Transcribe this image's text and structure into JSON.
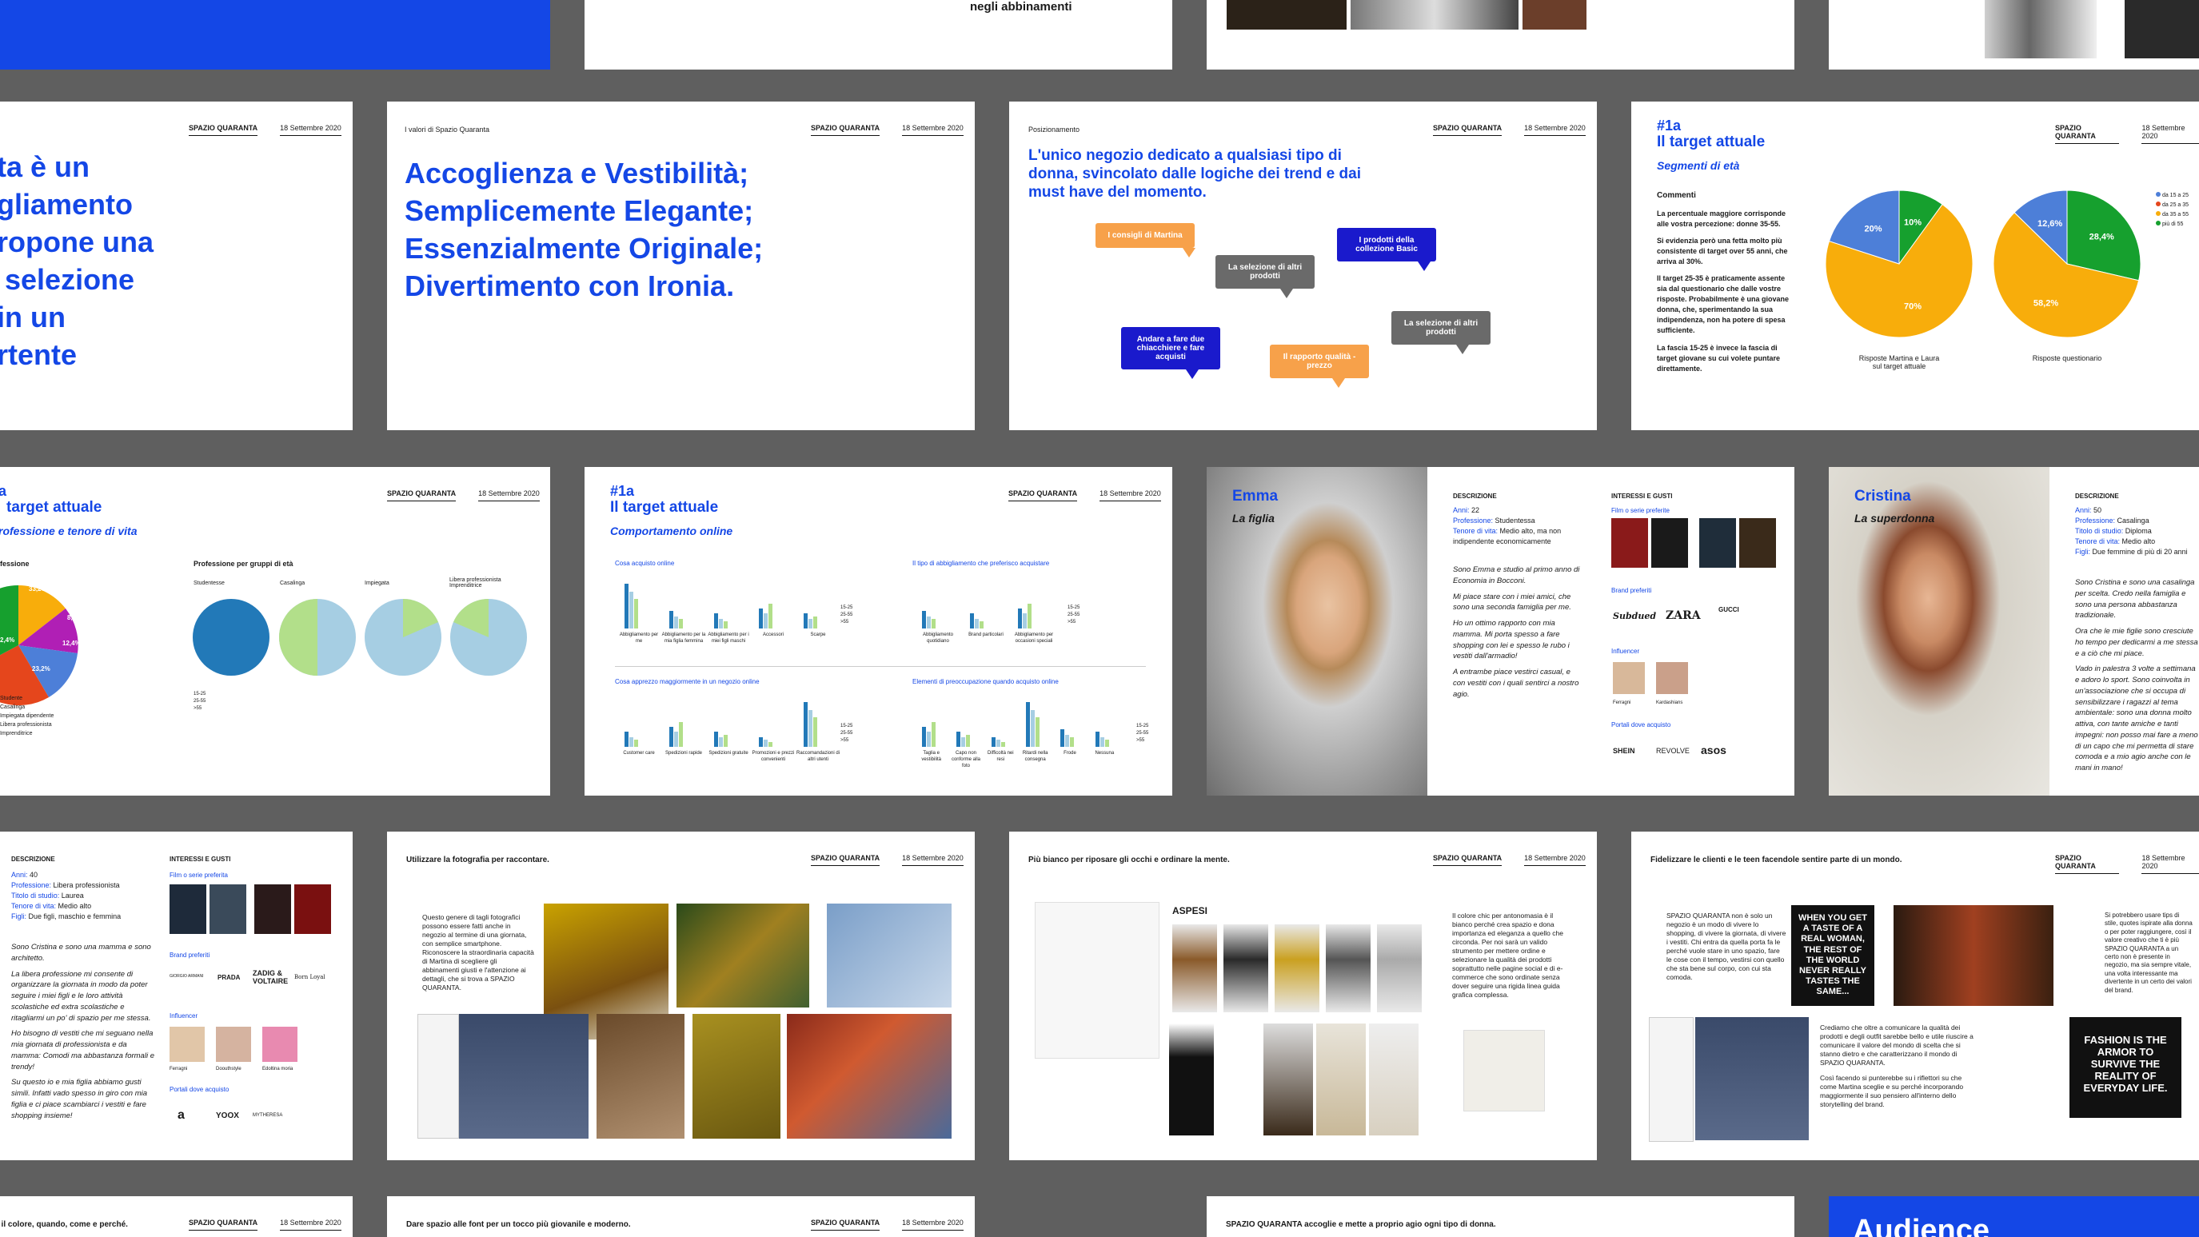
{
  "colors": {
    "accent": "#1447e6",
    "bg": "#5f5f5f",
    "orange": "#f7a14a",
    "gray": "#6a6a6a",
    "navy": "#1a1acc",
    "pie_blue": "#4d7fd8",
    "pie_orange": "#f8ad0b",
    "pie_green": "#16a02e",
    "pie_red": "#e5461c"
  },
  "top_row": {
    "subtitle": "negli abbinamenti"
  },
  "header": {
    "brand": "SPAZIO QUARANTA",
    "date": "18 Settembre 2020"
  },
  "slide_claim": {
    "lines": [
      "ta è un",
      "gliamento",
      "ropone una",
      " selezione",
      "in un",
      "rtente"
    ]
  },
  "slide_values": {
    "section": "I valori di Spazio Quaranta",
    "lines": [
      "Accoglienza e Vestibilità;",
      "Semplicemente Elegante;",
      "Essenzialmente Originale;",
      "Divertimento con Ironia."
    ]
  },
  "slide_position": {
    "section": "Posizionamento",
    "statement": "L'unico negozio dedicato a qualsiasi tipo di donna, svincolato dalle logiche dei trend e dai must have del momento.",
    "bubbles": [
      "I consigli di Martina",
      "La selezione di altri prodotti",
      "I prodotti della collezione Basic",
      "Andare a fare due chiacchiere e fare acquisti",
      "Il rapporto qualità - prezzo",
      "La selezione di altri prodotti"
    ]
  },
  "slide_target": {
    "tag": "#1a",
    "title": "Il target attuale",
    "subtitle": "Segmenti di età",
    "comments_label": "Commenti",
    "paragraphs": [
      "La percentuale maggiore corrisponde alle vostra percezione: donne 35-55.",
      "Si evidenzia però una fetta molto più consistente di target over 55 anni, che arriva al 30%.",
      "Il target 25-35 è praticamente assente sia dal questionario che dalle vostre risposte. Probabilmente è una giovane donna, che, sperimentando la sua indipendenza, non ha potere di spesa sufficiente.",
      "La fascia 15-25 è invece la fascia di target giovane su cui volete puntare direttamente."
    ],
    "pie1_caption": "Risposte Martina e Laura sul target attuale",
    "pie2_caption": "Risposte questionario",
    "legend": [
      "da 15 a 25",
      "da 25 a 35",
      "da 35 a 55",
      "più di 55"
    ]
  },
  "chart_data": [
    {
      "type": "pie",
      "title": "",
      "labels": [
        "da 15 a 25",
        "da 35 a 55",
        "più di 55"
      ],
      "values": [
        10,
        70,
        20
      ],
      "value_labels": [
        "10%",
        "70%",
        "20%"
      ]
    },
    {
      "type": "pie",
      "title": "",
      "labels": [
        "da 15 a 25",
        "da 35 a 55",
        "più di 55"
      ],
      "values": [
        28.4,
        58.2,
        12.6
      ],
      "value_labels": [
        "28,4%",
        "58,2%",
        "12,6%"
      ]
    }
  ],
  "slide_profession": {
    "tag": "a",
    "title": "target attuale",
    "subtitle": "rofessione e tenore di vita",
    "pie_label": "fessione",
    "pie_values": [
      "33,2%",
      "8,9%",
      "12,4%",
      "23,2%",
      "2,4%"
    ],
    "legend": [
      "Studente",
      "Casalinga",
      "Impiegata dipendente",
      "Libera professionista",
      "Imprenditrice"
    ],
    "group_title": "Professione per gruppi di età",
    "groups": [
      "Studentesse",
      "Casalinga",
      "Impiegata",
      "Libera professionista Imprenditrice"
    ],
    "group_legend": [
      "15-25",
      "25-55",
      ">55"
    ]
  },
  "slide_online": {
    "tag": "#1a",
    "title": "Il target attuale",
    "subtitle": "Comportamento online",
    "charts": [
      {
        "title": "Cosa acquisto online",
        "cats": [
          "Abbigliamento per me",
          "Abbigliamento per la mia figlia femmina",
          "Abbigliamento per i miei figli maschi",
          "Accessori",
          "Scarpe"
        ]
      },
      {
        "title": "Il tipo di abbigliamento che preferisco acquistare",
        "cats": [
          "Abbigliamento quotidiano",
          "Brand particolari",
          "Abbigliamento per occasioni speciali"
        ]
      },
      {
        "title": "Cosa apprezzo maggiormente in un negozio online",
        "cats": [
          "Customer care",
          "Spedizioni rapide",
          "Spedizioni gratuite",
          "Promozioni e prezzi convenienti",
          "Raccomandazioni di altri utenti"
        ]
      },
      {
        "title": "Elementi di preoccupazione quando acquisto online",
        "cats": [
          "Taglia e vestibilità",
          "Capo non conforme alla foto",
          "Difficoltà nei resi",
          "Ritardi nella consegna",
          "Frode",
          "Nessuna"
        ]
      }
    ],
    "legend": [
      "15-25",
      "25-55",
      ">55"
    ]
  },
  "persona_emma": {
    "name": "Emma",
    "role": "La figlia",
    "desc_label": "DESCRIZIONE",
    "facts": [
      [
        "Anni:",
        "22"
      ],
      [
        "Professione:",
        "Studentessa"
      ],
      [
        "Tenore di vita:",
        "Medio alto, ma non indipendente economicamente"
      ]
    ],
    "story": [
      "Sono Emma e studio al primo anno di Economia in Bocconi.",
      "Mi piace stare con i miei amici, che sono una seconda famiglia per me.",
      "Ho un ottimo rapporto con mia mamma. Mi porta spesso a fare shopping con lei e spesso le rubo i vestiti dall'armadio!",
      "A entrambe piace vestirci casual, e con vestiti con i quali sentirci a nostro agio."
    ],
    "interests_label": "INTERESSI E GUSTI",
    "films_label": "Film o serie preferite",
    "brands_label": "Brand preferiti",
    "brands": [
      "Subdued",
      "ZARA",
      "GUCCI"
    ],
    "influencer_label": "Influencer",
    "influencers": [
      "Ferragni",
      "Kardashians"
    ],
    "portals_label": "Portali dove acquisto",
    "portals": [
      "SHEIN",
      "REVOLVE",
      "asos"
    ]
  },
  "persona_cristina": {
    "name": "Cristina",
    "role": "La superdonna",
    "desc_label": "DESCRIZIONE",
    "facts": [
      [
        "Anni:",
        "50"
      ],
      [
        "Professione:",
        "Casalinga"
      ],
      [
        "Titolo di studio:",
        "Diploma"
      ],
      [
        "Tenore di vita:",
        "Medio alto"
      ],
      [
        "Figli:",
        "Due femmine di più di 20 anni"
      ]
    ],
    "story": [
      "Sono Cristina e sono una casalinga per scelta. Credo nella famiglia e sono una persona abbastanza tradizionale.",
      "Ora che le mie figlie sono cresciute ho tempo per dedicarmi a me stessa e a ciò che mi piace.",
      "Vado in palestra 3 volte a settimana e adoro lo sport. Sono coinvolta in un'associazione che si occupa di sensibilizzare i ragazzi al tema ambientale: sono una donna molto attiva, con tante amiche e tanti impegni: non posso mai fare a meno di un capo che mi permetta di stare comoda e a mio agio anche con le mani in mano!"
    ]
  },
  "persona_third": {
    "desc_label": "DESCRIZIONE",
    "facts": [
      [
        "Anni:",
        "40"
      ],
      [
        "Professione:",
        "Libera professionista"
      ],
      [
        "Titolo di studio:",
        "Laurea"
      ],
      [
        "Tenore di vita:",
        "Medio alto"
      ],
      [
        "Figli:",
        "Due figli, maschio e femmina"
      ]
    ],
    "story": [
      "Sono Cristina e sono una mamma e sono architetto.",
      "La libera professione mi consente di organizzare la giornata in modo da poter seguire i miei figli e le loro attività scolastiche ed extra scolastiche e ritagliarmi un po' di spazio per me stessa.",
      "Ho bisogno di vestiti che mi seguano nella mia giornata di professionista e da mamma: Comodi ma abbastanza formali e trendy!",
      "Su questo io e mia figlia abbiamo gusti simili. Infatti vado spesso in giro con mia figlia e ci piace scambiarci i vestiti e fare shopping insieme!"
    ],
    "interests_label": "INTERESSI E GUSTI",
    "films_label": "Film o serie preferita",
    "brands_label": "Brand preferiti",
    "brands": [
      "GIORGIO ARMANI",
      "PRADA",
      "ZADIG & VOLTAIRE",
      "Born Loyal"
    ],
    "influencer_label": "Influencer",
    "influencers": [
      "Ferragni",
      "Doouthstyle",
      "Edoltina moria"
    ],
    "portals_label": "Portali dove acquisto",
    "portals": [
      "a",
      "YOOX",
      "MYTHERESA"
    ]
  },
  "slide_photo": {
    "title": "Utilizzare la fotografia per raccontare.",
    "body": "Questo genere di tagli fotografici possono essere fatti anche in negozio al termine di una giornata, con semplice smartphone. Riconoscere la straordinaria capacità di Martina di scegliere gli abbinamenti giusti e l'attenzione ai dettagli, che si trova a SPAZIO QUARANTA."
  },
  "slide_white": {
    "title": "Più bianco per riposare gli occhi e ordinare la mente.",
    "shop": "ASPESI",
    "body": "Il colore chic per antonomasia è il bianco perché crea spazio e dona importanza ed eleganza a quello che circonda. Per noi sarà un valido strumento per mettere ordine e selezionare la qualità dei prodotti soprattutto nelle pagine social e di e-commerce che sono ordinate senza dover seguire una rigida linea guida grafica complessa."
  },
  "slide_loyal": {
    "title": "Fidelizzare le clienti e le teen facendole sentire parte di un mondo.",
    "body1": "SPAZIO QUARANTA non è solo un negozio è un modo di vivere lo shopping, di vivere la giornata, di vivere i vestiti. Chi entra da quella porta fa le perché vuole stare in uno spazio, fare le cose con il tempo, vestirsi con quello che sta bene sul corpo, con cui sta comoda.",
    "quote1": "WHEN YOU GET A TASTE OF A REAL WOMAN, THE REST OF THE WORLD NEVER REALLY TASTES THE SAME...",
    "body2": "Crediamo che oltre a comunicare la qualità dei prodotti e degli outfit sarebbe bello e utile riuscire a comunicare il valore del mondo di scelta che si stanno dietro e che caratterizzano il mondo di SPAZIO QUARANTA.",
    "body3": "Così facendo si punterebbe su i riflettori su che come Martina sceglie e su perché incorporando maggiormente il suo pensiero all'interno dello storytelling del brand.",
    "side": "Si potrebbero usare tips di stile, quotes ispirate alla donna o per poter raggiungere, così il valore creativo che ti è più SPAZIO QUARANTA a un certo non è presente in negozio, ma sia sempre vitale, una volta interessante ma divertente in un certo dei valori del brand.",
    "quote2": "FASHION IS THE ARMOR TO SURVIVE THE REALITY OF EVERYDAY LIFE."
  },
  "bottom_row": {
    "t1": "i il colore, quando, come e perché.",
    "t2": "Dare spazio alle font per un tocco più giovanile e moderno.",
    "t3": "SPAZIO QUARANTA accoglie e mette a proprio agio ogni tipo di donna.",
    "t4": "Audience"
  }
}
